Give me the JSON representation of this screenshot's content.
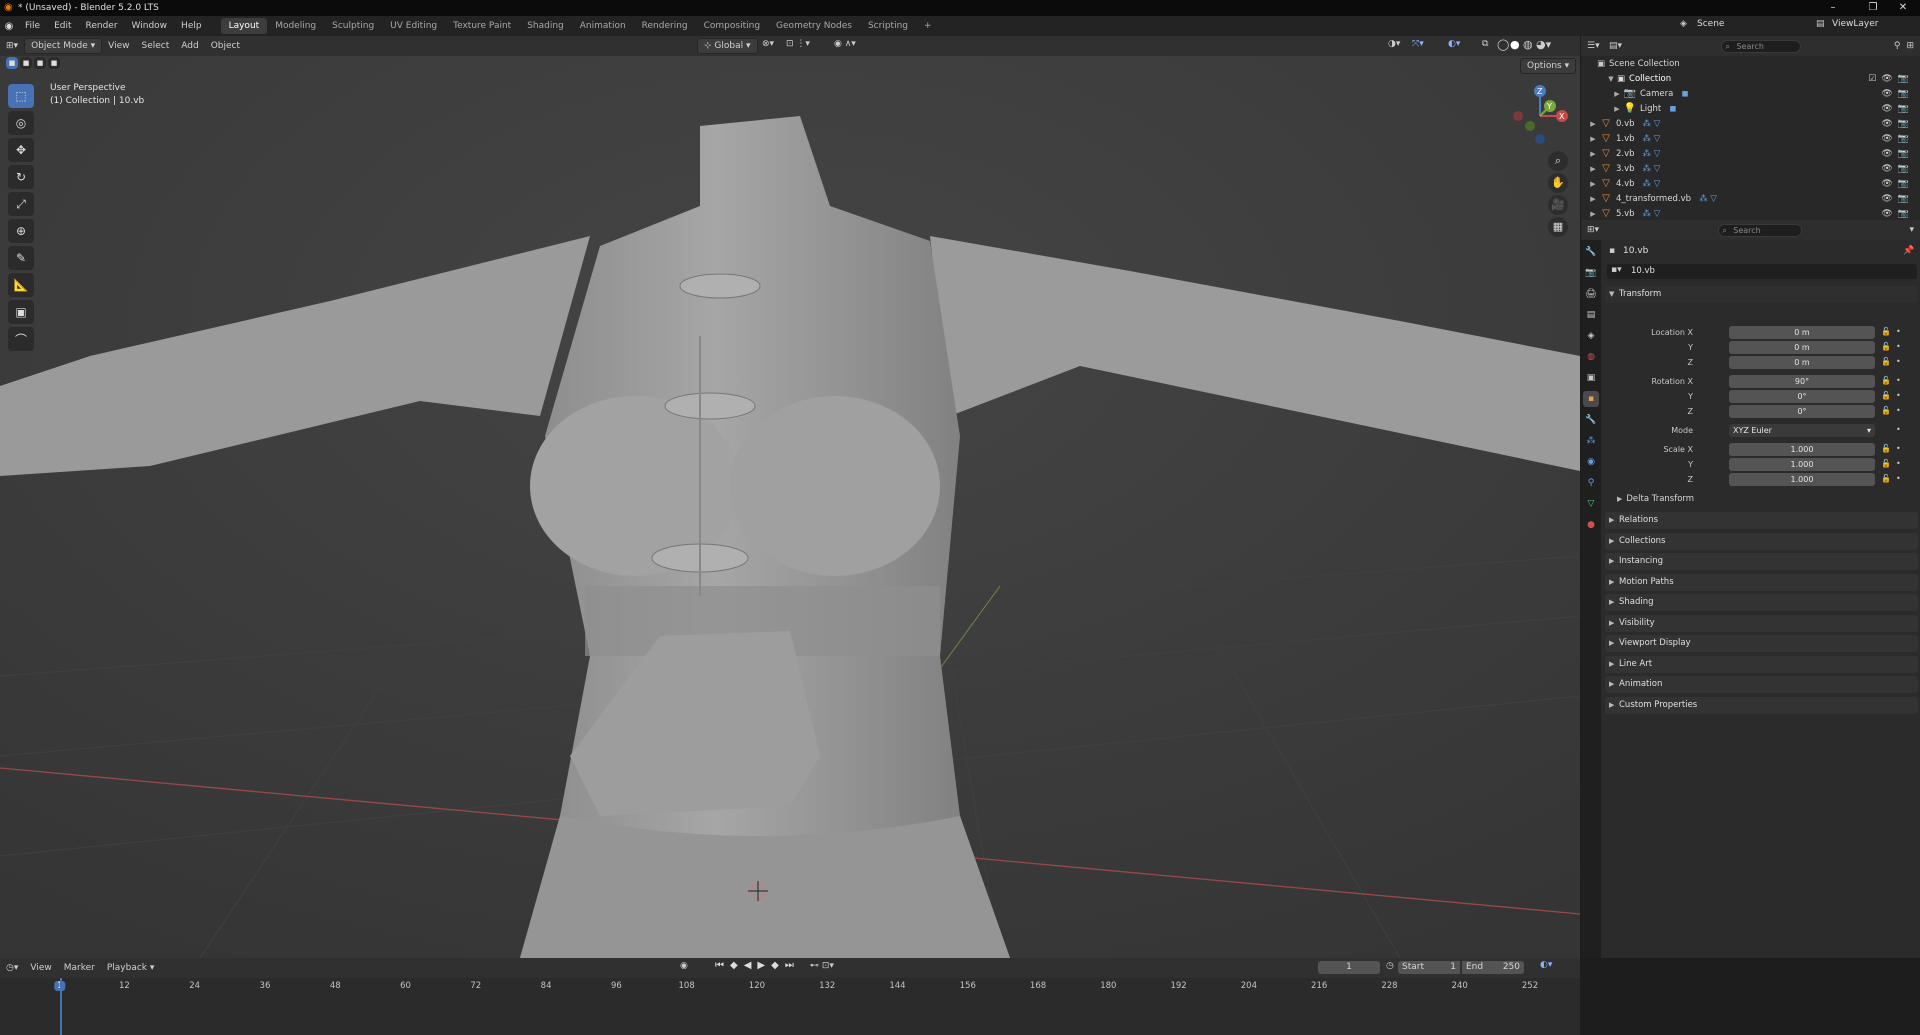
{
  "window": {
    "title": "* (Unsaved) - Blender 5.2.0 LTS"
  },
  "menus": [
    "File",
    "Edit",
    "Render",
    "Window",
    "Help"
  ],
  "workspaces": [
    "Layout",
    "Modeling",
    "Sculpting",
    "UV Editing",
    "Texture Paint",
    "Shading",
    "Animation",
    "Rendering",
    "Compositing",
    "Geometry Nodes",
    "Scripting",
    "+"
  ],
  "active_workspace": "Layout",
  "scene": {
    "name": "Scene",
    "view_layer": "ViewLayer"
  },
  "viewport_header": {
    "mode": "Object Mode",
    "view": "View",
    "select": "Select",
    "add": "Add",
    "object": "Object",
    "orientation": "Global",
    "options": "Options"
  },
  "viewport": {
    "perspective": "User Perspective",
    "context": "(1) Collection | 10.vb"
  },
  "gizmo": {
    "z": "Z",
    "y": "Y",
    "x": "X"
  },
  "outliner": {
    "search_placeholder": "Search",
    "scene_collection": "Scene Collection",
    "collection": "Collection",
    "items": [
      {
        "name": "Camera",
        "type": "camera"
      },
      {
        "name": "Light",
        "type": "light"
      },
      {
        "name": "0.vb",
        "type": "mesh"
      },
      {
        "name": "1.vb",
        "type": "mesh"
      },
      {
        "name": "2.vb",
        "type": "mesh"
      },
      {
        "name": "3.vb",
        "type": "mesh"
      },
      {
        "name": "4.vb",
        "type": "mesh"
      },
      {
        "name": "4_transformed.vb",
        "type": "mesh"
      },
      {
        "name": "5.vb",
        "type": "mesh"
      }
    ]
  },
  "properties": {
    "search_placeholder": "Search",
    "object_name": "10.vb",
    "datablock": "10.vb",
    "transform_title": "Transform",
    "location_label": "Location X",
    "location": [
      "0 m",
      "0 m",
      "0 m"
    ],
    "rotation_label": "Rotation X",
    "rotation": [
      "90°",
      "0°",
      "0°"
    ],
    "mode_label": "Mode",
    "mode": "XYZ Euler",
    "scale_label": "Scale X",
    "scale": [
      "1.000",
      "1.000",
      "1.000"
    ],
    "axis_y": "Y",
    "axis_z": "Z",
    "delta_transform": "Delta Transform",
    "panels": [
      "Relations",
      "Collections",
      "Instancing",
      "Motion Paths",
      "Shading",
      "Visibility",
      "Viewport Display",
      "Line Art",
      "Animation",
      "Custom Properties"
    ]
  },
  "timeline": {
    "view": "View",
    "marker": "Marker",
    "playback": "Playback",
    "current_frame": "1",
    "start_label": "Start",
    "start": "1",
    "end_label": "End",
    "end": "250",
    "frames": [
      "1",
      "12",
      "24",
      "36",
      "48",
      "60",
      "72",
      "84",
      "96",
      "108",
      "120",
      "132",
      "144",
      "156",
      "168",
      "180",
      "192",
      "204",
      "216",
      "228",
      "240",
      "252"
    ]
  }
}
